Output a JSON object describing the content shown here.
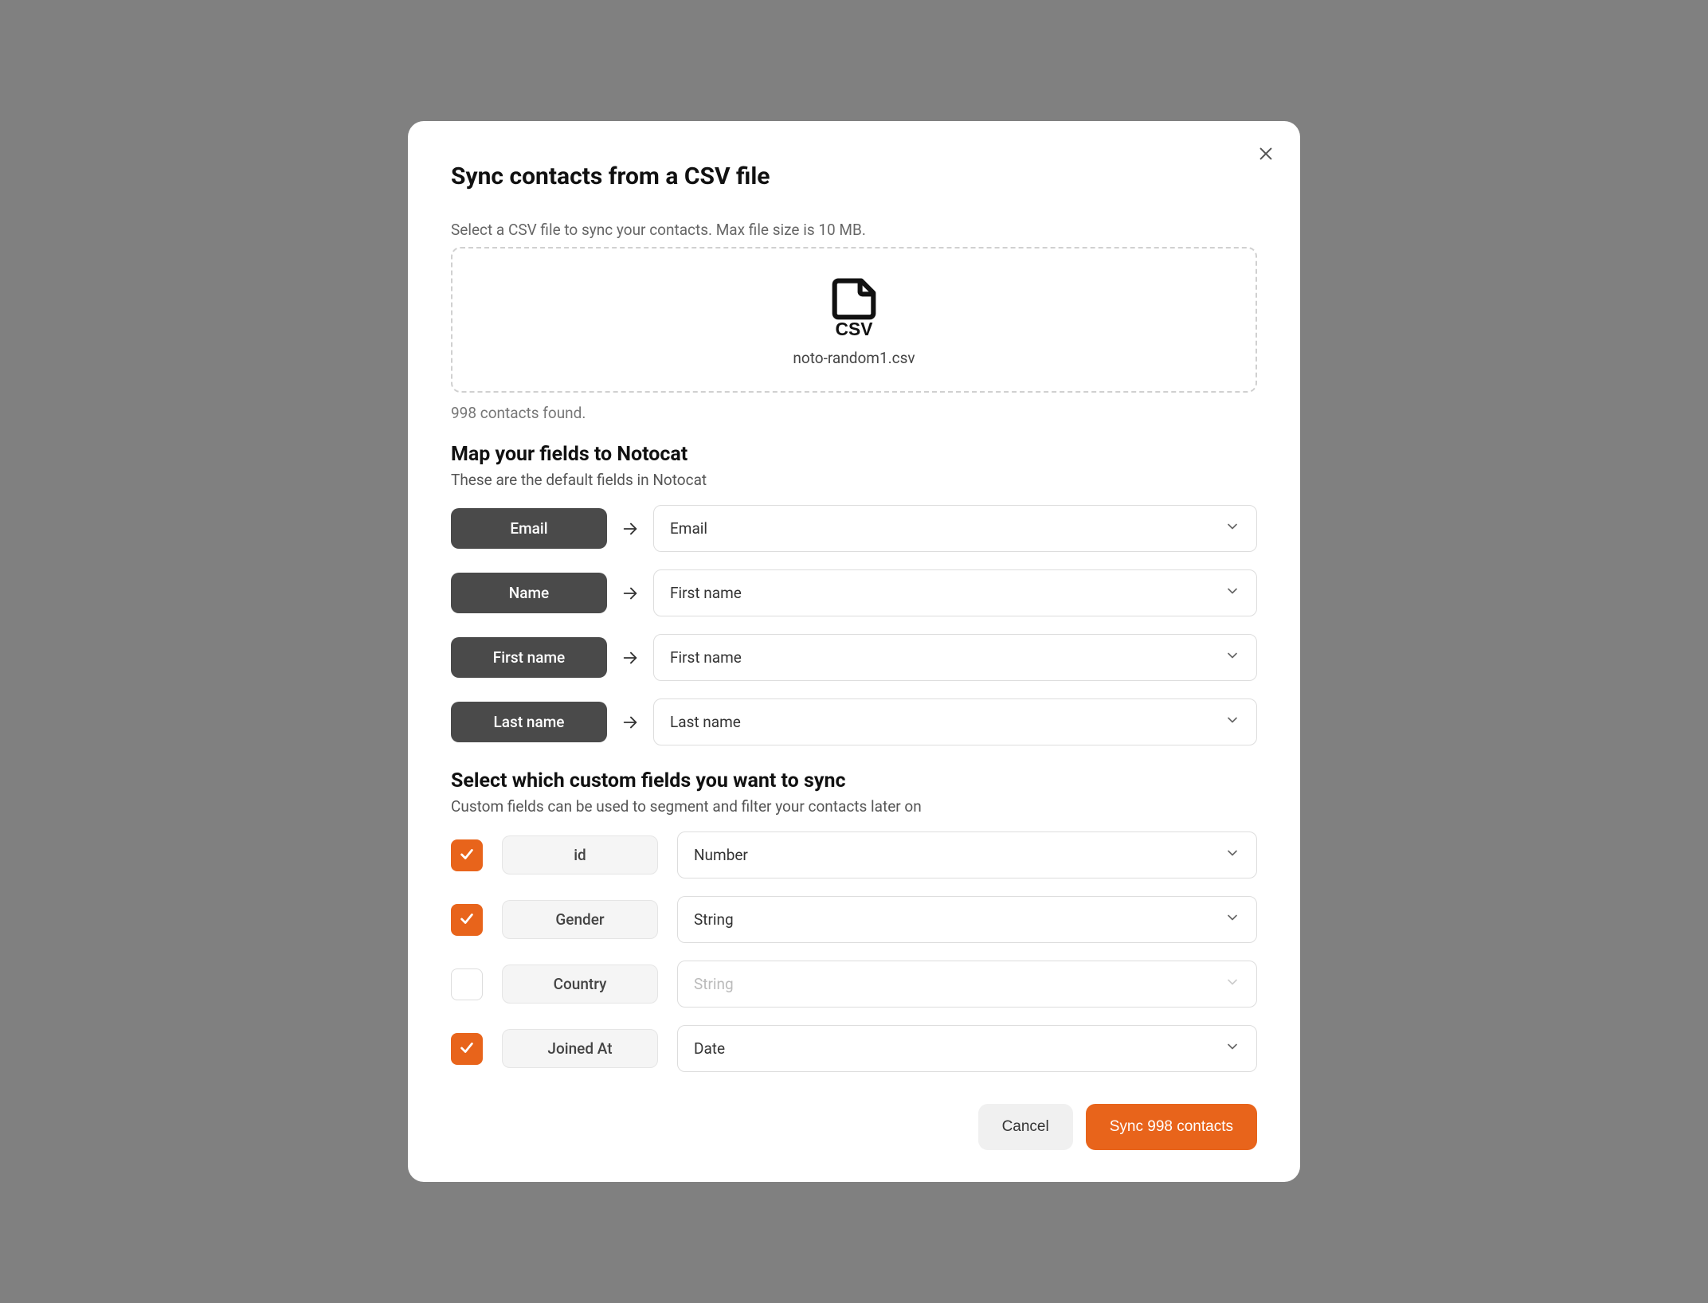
{
  "modal": {
    "title": "Sync contacts from a CSV file",
    "instruction": "Select a CSV file to sync your contacts. Max file size is 10 MB.",
    "filename": "noto-random1.csv",
    "contacts_found": "998 contacts found."
  },
  "mapping": {
    "heading": "Map your fields to Notocat",
    "subtext": "These are the default fields in Notocat",
    "rows": [
      {
        "source": "Email",
        "target": "Email"
      },
      {
        "source": "Name",
        "target": "First name"
      },
      {
        "source": "First name",
        "target": "First name"
      },
      {
        "source": "Last name",
        "target": "Last name"
      }
    ]
  },
  "custom": {
    "heading": "Select which custom fields you want to sync",
    "subtext": "Custom fields can be used to segment and filter your contacts later on",
    "rows": [
      {
        "checked": true,
        "name": "id",
        "type": "Number"
      },
      {
        "checked": true,
        "name": "Gender",
        "type": "String"
      },
      {
        "checked": false,
        "name": "Country",
        "type": "String"
      },
      {
        "checked": true,
        "name": "Joined At",
        "type": "Date"
      }
    ]
  },
  "footer": {
    "cancel": "Cancel",
    "sync": "Sync 998 contacts"
  }
}
